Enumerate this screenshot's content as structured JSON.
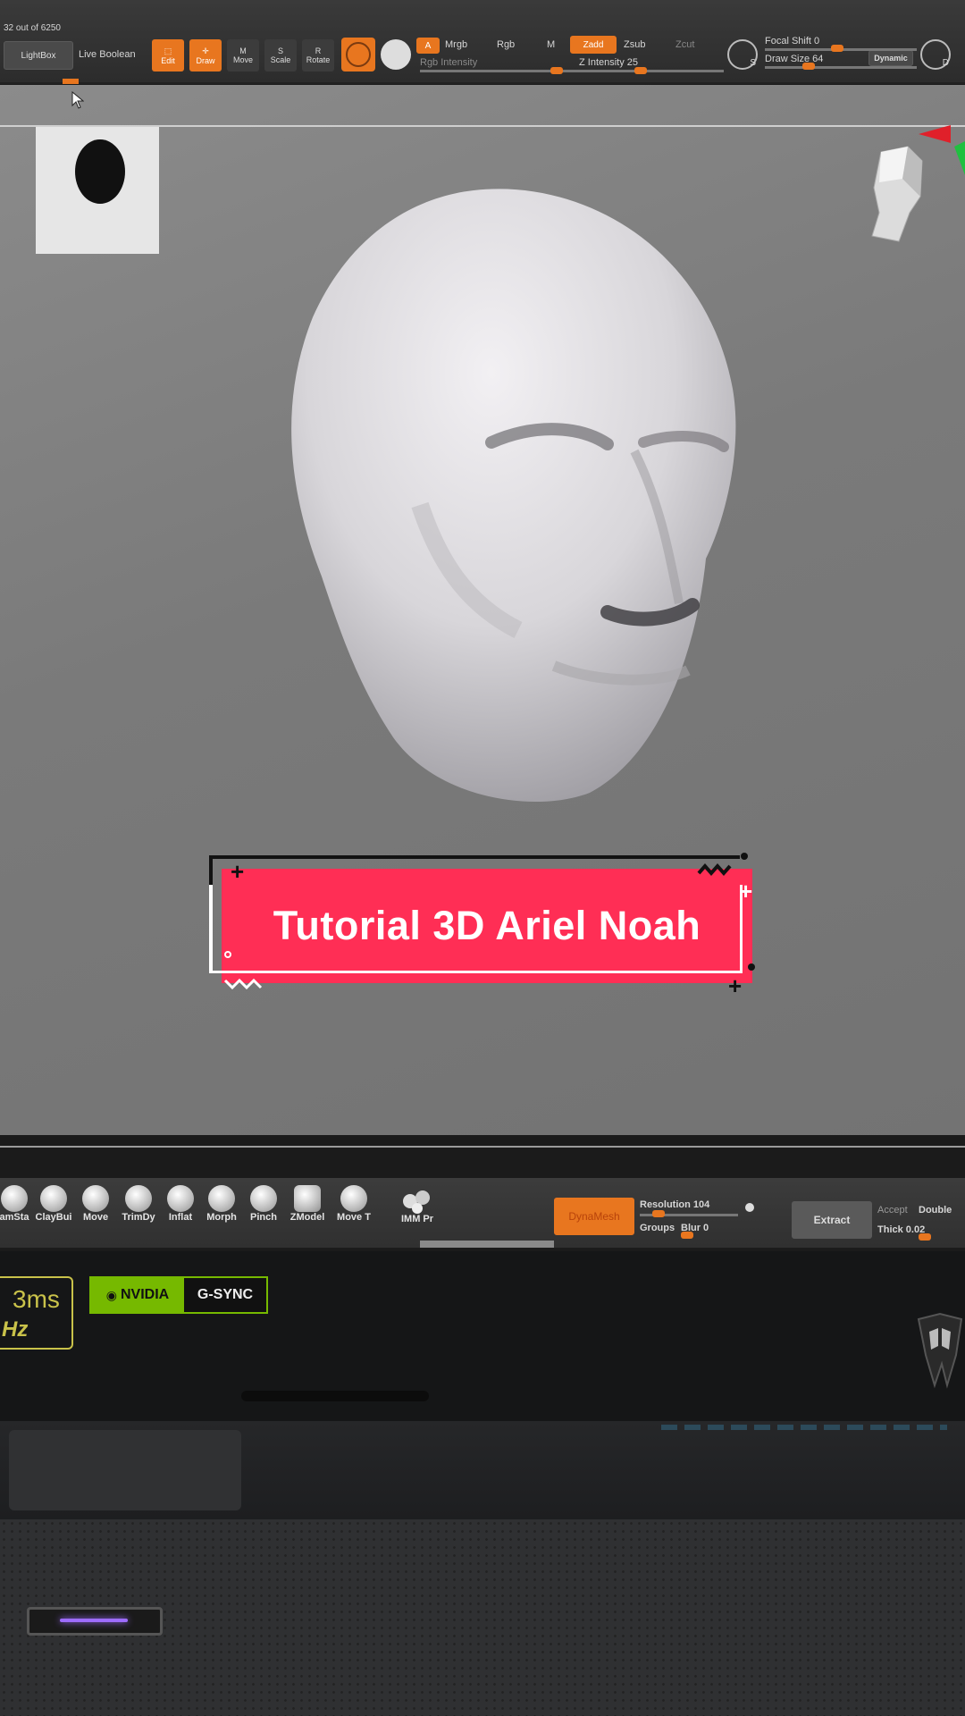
{
  "toolbar": {
    "poly_count": "32 out of 6250",
    "lightbox_label": "LightBox",
    "live_boolean_label": "Live Boolean",
    "tools": [
      {
        "name": "edit",
        "label": "Edit",
        "active": true
      },
      {
        "name": "draw",
        "label": "Draw",
        "active": true
      },
      {
        "name": "move",
        "label": "Move",
        "active": false
      },
      {
        "name": "scale",
        "label": "Scale",
        "active": false
      },
      {
        "name": "rotate",
        "label": "Rotate",
        "active": false
      }
    ],
    "mode_a": "A",
    "mrgb": "Mrgb",
    "rgb": "Rgb",
    "m": "M",
    "zadd": "Zadd",
    "zsub": "Zsub",
    "zcut": "Zcut",
    "rgb_intensity": "Rgb Intensity",
    "z_intensity": "Z Intensity 25",
    "focal_shift": "Focal Shift 0",
    "draw_size": "Draw Size 64",
    "dynamic": "Dynamic",
    "s_icon": "S",
    "d_icon": "D"
  },
  "brushes": [
    "amSta",
    "ClayBui",
    "Move",
    "TrimDy",
    "Inflat",
    "Morph",
    "Pinch",
    "ZModel",
    "Move T"
  ],
  "imm_label": "IMM Pr",
  "dynamesh": {
    "button": "DynaMesh",
    "resolution": "Resolution 104",
    "groups": "Groups",
    "blur": "Blur 0"
  },
  "extract": {
    "button": "Extract",
    "accept": "Accept",
    "double": "Double",
    "thick": "Thick 0.02"
  },
  "bezel": {
    "ms_label": "3ms",
    "hz_label": "Hz",
    "nvidia": "NVIDIA",
    "gsync": "G-SYNC"
  },
  "banner": {
    "title": "Tutorial 3D Ariel Noah"
  },
  "colors": {
    "accent_orange": "#e8761f",
    "banner_red": "#ff2e55",
    "nvidia_green": "#76b900"
  }
}
